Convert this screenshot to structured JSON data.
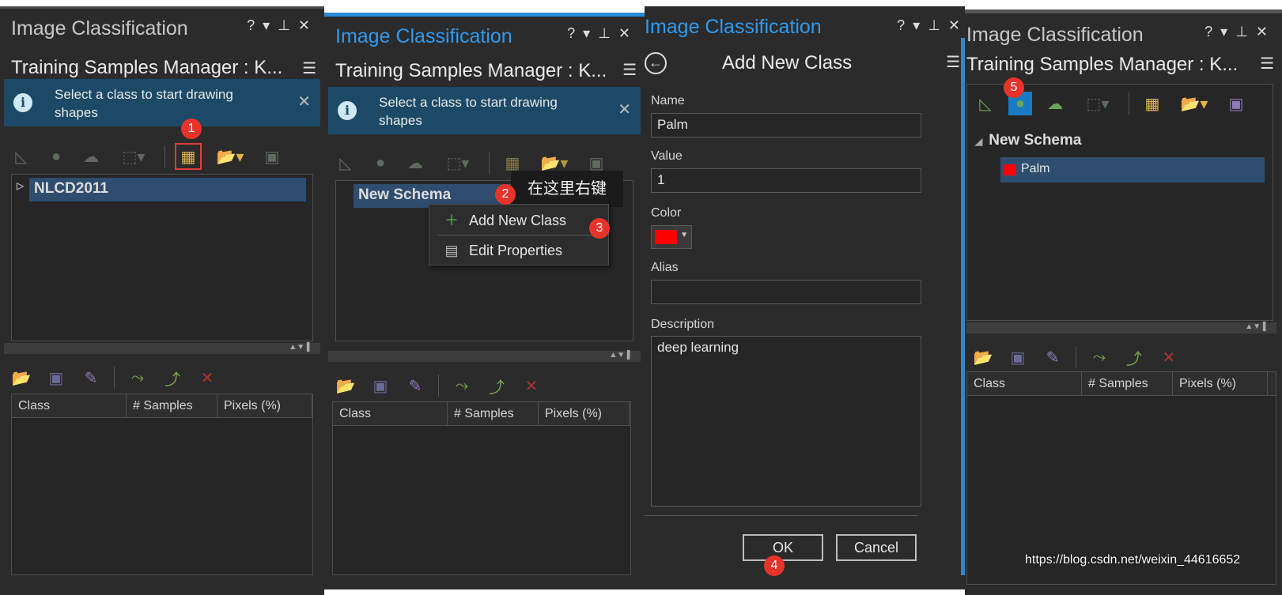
{
  "panel1": {
    "title": "Image Classification",
    "subtitle": "Training Samples Manager : K...",
    "banner_message": "Select a class to start drawing shapes",
    "tree_item": "NLCD2011",
    "columns": [
      "Class",
      "# Samples",
      "Pixels (%)"
    ]
  },
  "panel2": {
    "title": "Image Classification",
    "subtitle": "Training Samples Manager : K...",
    "banner_message": "Select a class to start drawing shapes",
    "tree_item": "New Schema",
    "tooltip": "在这里右键",
    "context_menu": [
      {
        "label": "Add New Class",
        "icon": "plus-icon"
      },
      {
        "label": "Edit Properties",
        "icon": "properties-icon"
      }
    ],
    "columns": [
      "Class",
      "# Samples",
      "Pixels (%)"
    ]
  },
  "panel3": {
    "title": "Image Classification",
    "heading": "Add New Class",
    "fields": {
      "name_label": "Name",
      "name_value": "Palm",
      "value_label": "Value",
      "value_value": "1",
      "color_label": "Color",
      "color_value": "#ff0000",
      "alias_label": "Alias",
      "alias_value": "",
      "description_label": "Description",
      "description_value": "deep learning"
    },
    "ok_label": "OK",
    "cancel_label": "Cancel"
  },
  "panel4": {
    "title": "Image Classification",
    "subtitle": "Training Samples Manager : K...",
    "tree_item": "New Schema",
    "class_item": "Palm",
    "class_color": "#ff0000",
    "columns": [
      "Class",
      "# Samples",
      "Pixels (%)"
    ]
  },
  "badges": [
    "1",
    "2",
    "3",
    "4",
    "5"
  ],
  "watermark": "https://blog.csdn.net/weixin_44616652",
  "colors": {
    "panel_bg": "#2b2b2b",
    "accent_blue": "#2f9af0",
    "banner_bg": "#1c4a66",
    "selection": "#2f4d6e",
    "badge_red": "#e8332a"
  }
}
